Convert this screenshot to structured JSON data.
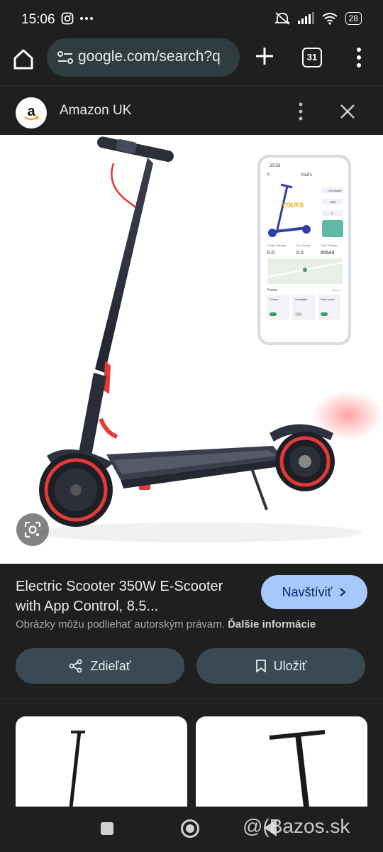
{
  "status_bar": {
    "time": "15:06",
    "battery": "28",
    "left_icons": [
      "instagram-icon",
      "more-dots-icon"
    ],
    "right_icons": [
      "mute-icon",
      "signal-icon",
      "wifi-icon",
      "battery-icon"
    ]
  },
  "browser": {
    "url": "google.com/search?q",
    "tab_count": "31",
    "icons": [
      "home-icon",
      "site-settings-icon",
      "plus-icon",
      "tabs-icon",
      "menu-icon"
    ]
  },
  "source": {
    "name": "Amazon UK",
    "icons": [
      "amazon-logo",
      "more-vert-icon",
      "close-icon"
    ]
  },
  "image": {
    "phone_app_name": "Youf's",
    "phone_logo_text": "YOUFS",
    "phone_time": "20:53",
    "phone_status": "Connected",
    "phone_battery": "88%",
    "phone_speed": "5",
    "stat_single_label": "Single Mileage",
    "stat_single_value": "0.0",
    "stat_range_label": "Est. Range",
    "stat_range_value": "0.0",
    "stat_total_label": "Total Mileage",
    "stat_total_value": "65543",
    "unit": "km",
    "funcs_label": "Funcs",
    "more_label": "More >",
    "func_cruise": "Cruise",
    "func_headlight": "Headlight",
    "func_start": "Start mode"
  },
  "details": {
    "title": "Electric Scooter 350W E-Scooter with App Control, 8.5...",
    "visit_label": "Navštíviť",
    "copyright_text": "Obrázky môžu podliehať autorským právam.",
    "copyright_link": "Ďalšie informácie",
    "share_label": "Zdieľať",
    "save_label": "Uložiť"
  },
  "watermark": "@(Bazos.sk",
  "colors": {
    "background": "#1f1f1f",
    "url_pill": "#2f3c40",
    "visit_button": "#a8c7fa",
    "action_button": "#3a4a55",
    "scooter_accent": "#e53935"
  }
}
